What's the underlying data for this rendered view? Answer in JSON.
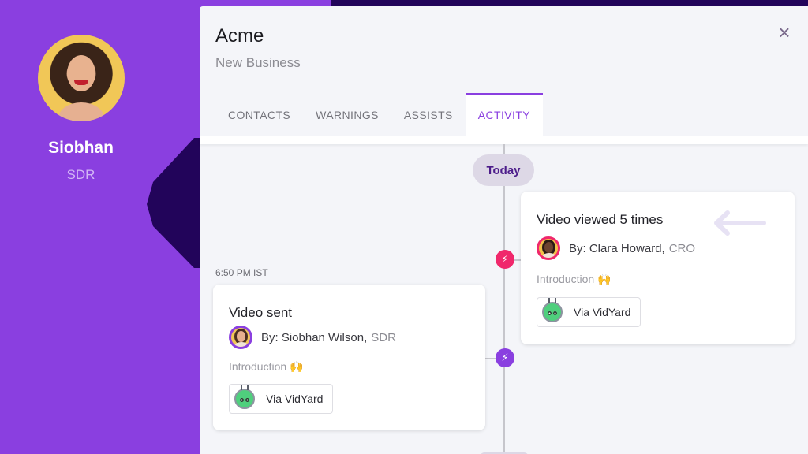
{
  "profile": {
    "name": "Siobhan",
    "role": "SDR"
  },
  "panel": {
    "title": "Acme",
    "subtitle": "New Business",
    "close_icon": "×"
  },
  "tabs": [
    {
      "label": "CONTACTS",
      "active": false
    },
    {
      "label": "WARNINGS",
      "active": false
    },
    {
      "label": "ASSISTS",
      "active": false
    },
    {
      "label": "ACTIVITY",
      "active": true
    }
  ],
  "timeline": {
    "date_pill": "Today",
    "node_icon": "⚡",
    "events": [
      {
        "title": "Video viewed 5 times",
        "by_label": "By: Clara Howard,",
        "by_role": "CRO",
        "topic": "Introduction 🙌",
        "source": "Via VidYard",
        "node_color": "#f0286c"
      },
      {
        "time": "6:50 PM IST",
        "title": "Video sent",
        "by_label": "By: Siobhan Wilson,",
        "by_role": "SDR",
        "topic": "Introduction 🙌",
        "source": "Via VidYard",
        "node_color": "#8a3fe0"
      }
    ]
  },
  "colors": {
    "brand_purple": "#8a3fe0",
    "dark_purple": "#22045a",
    "accent_pink": "#f0286c"
  }
}
